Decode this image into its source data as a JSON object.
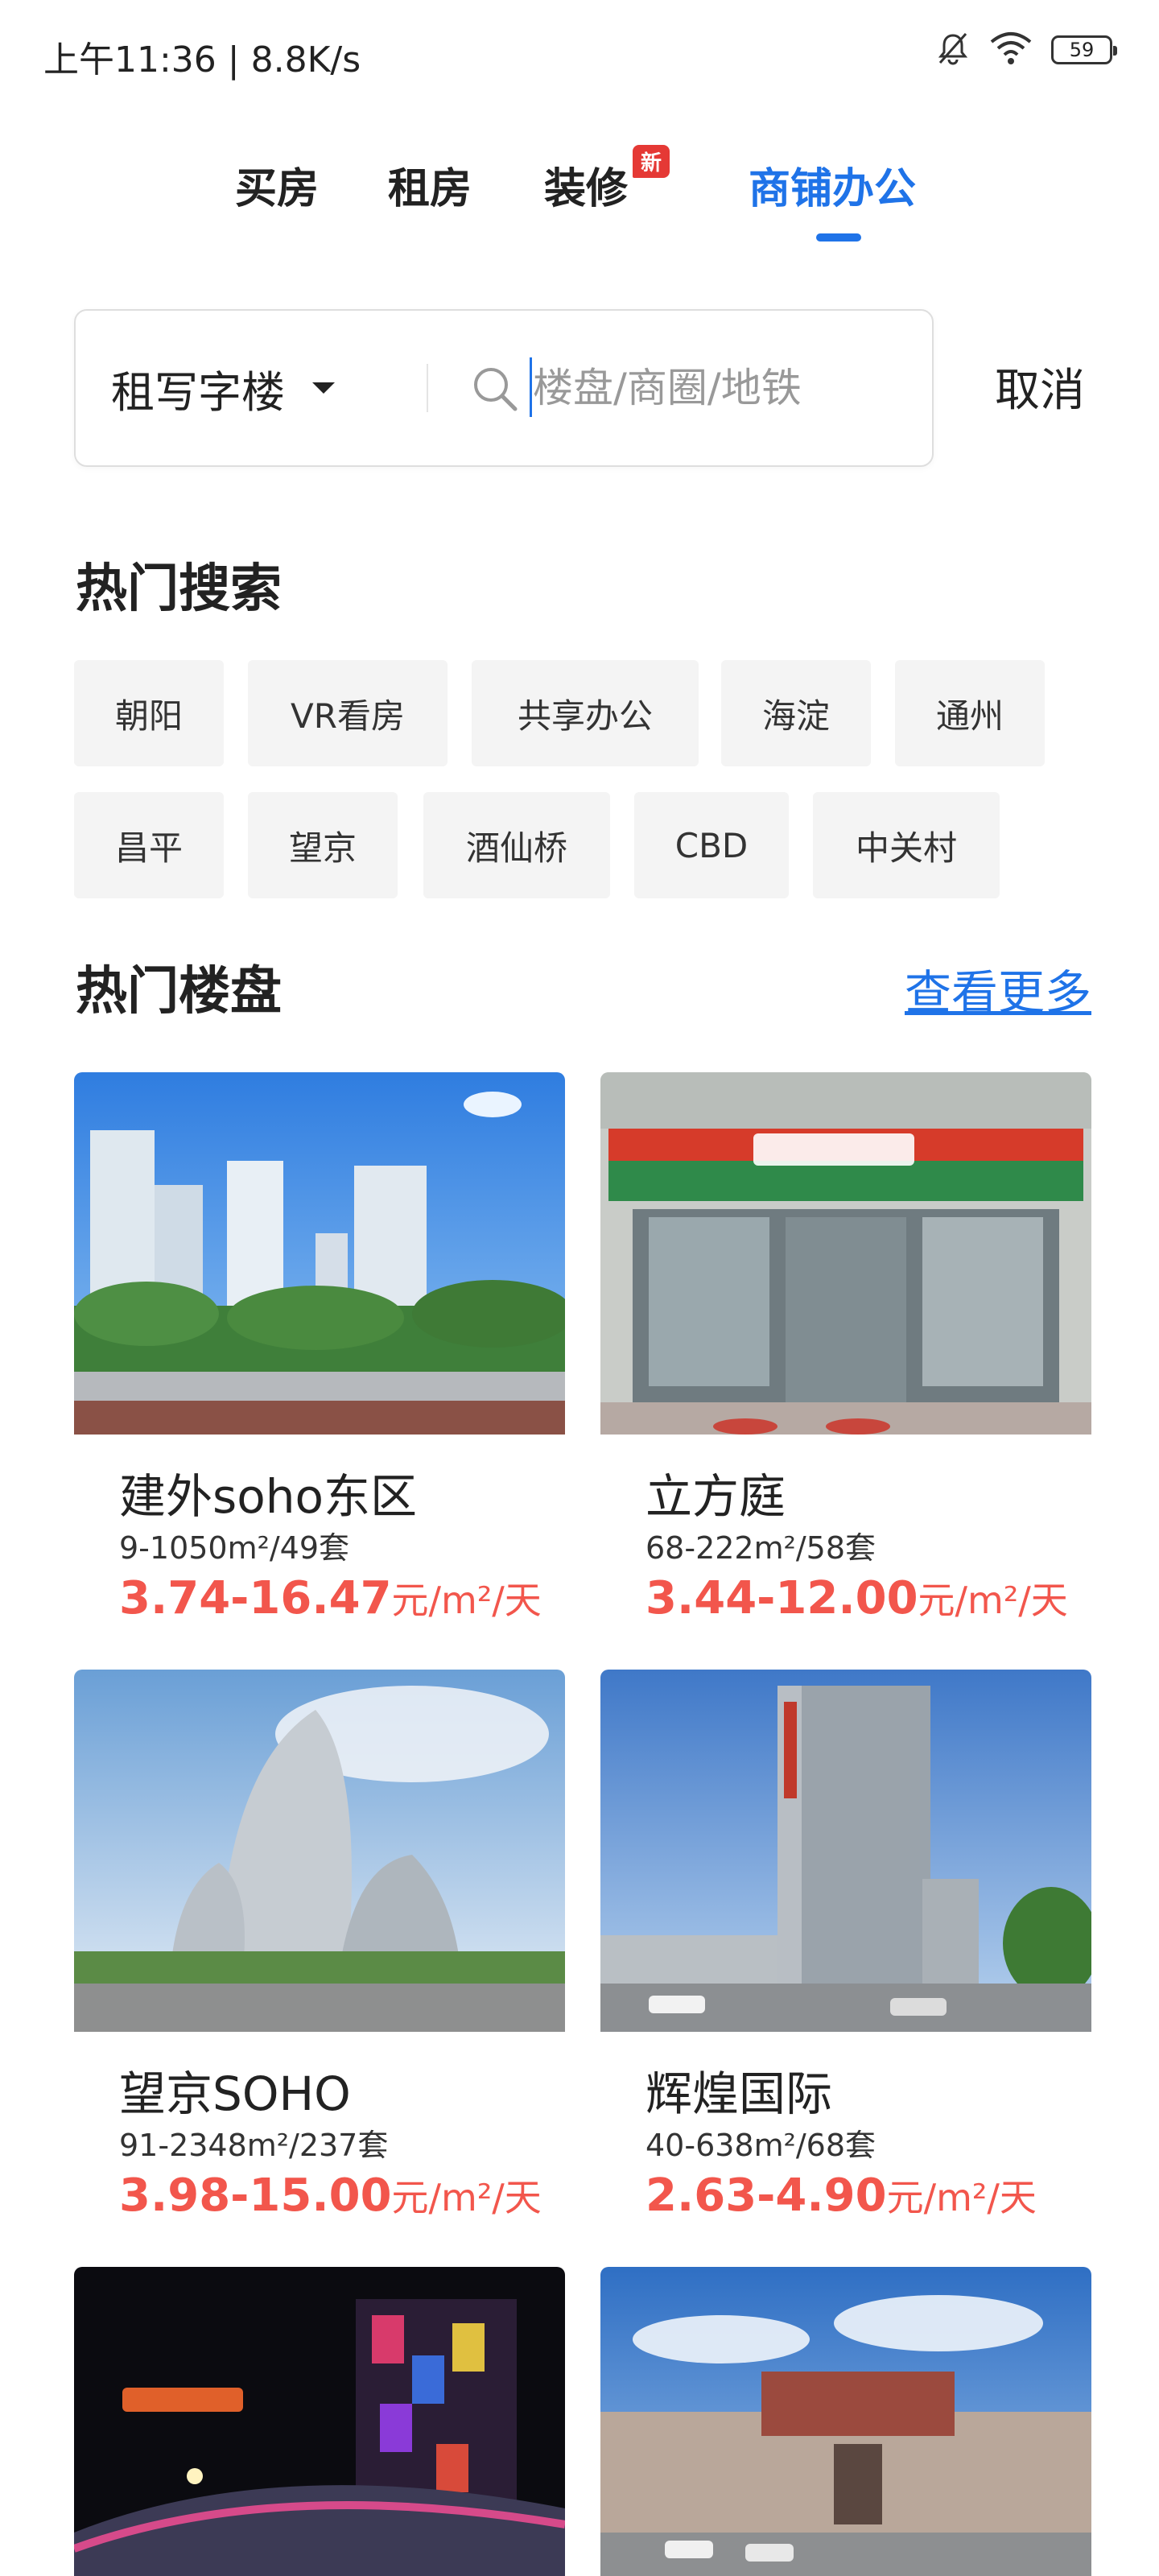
{
  "status_bar": {
    "time_speed": "上午11:36 | 8.8K/s",
    "battery": "59",
    "icons": [
      "mute-bell-icon",
      "wifi-icon",
      "battery-icon"
    ]
  },
  "top_tabs": [
    {
      "label": "买房",
      "active": false
    },
    {
      "label": "租房",
      "active": false
    },
    {
      "label": "装修",
      "active": false,
      "badge": "新"
    },
    {
      "label": "商铺办公",
      "active": true
    }
  ],
  "search": {
    "type_selected": "租写字楼",
    "placeholder": "楼盘/商圈/地铁",
    "value": "",
    "cancel_label": "取消"
  },
  "hot_search": {
    "title": "热门搜索",
    "chips_row1": [
      "朝阳",
      "VR看房",
      "共享办公",
      "海淀",
      "通州"
    ],
    "chips_row2": [
      "昌平",
      "望京",
      "酒仙桥",
      "CBD",
      "中关村"
    ]
  },
  "hot_buildings": {
    "title": "热门楼盘",
    "more_label": "查看更多",
    "items": [
      {
        "name": "建外soho东区",
        "area": "9-1050m²/49套",
        "price": "3.74-16.47",
        "unit": "元/m²/天"
      },
      {
        "name": "立方庭",
        "area": "68-222m²/58套",
        "price": "3.44-12.00",
        "unit": "元/m²/天"
      },
      {
        "name": "望京SOHO",
        "area": "91-2348m²/237套",
        "price": "3.98-15.00",
        "unit": "元/m²/天"
      },
      {
        "name": "辉煌国际",
        "area": "40-638m²/68套",
        "price": "2.63-4.90",
        "unit": "元/m²/天"
      }
    ]
  },
  "colors": {
    "accent": "#1f73e8",
    "price": "#f2564c",
    "badge": "#e53935",
    "chip_bg": "#f4f4f4"
  }
}
